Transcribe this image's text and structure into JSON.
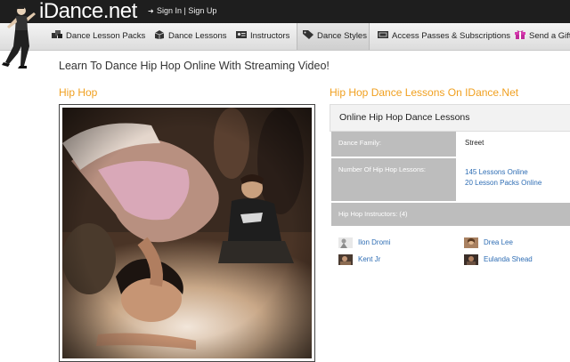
{
  "header": {
    "logo": "iDance.net",
    "auth_links": "Sign In | Sign Up"
  },
  "nav": {
    "items": [
      {
        "label": "Dance Lesson Packs",
        "icon": "lesson-packs-icon"
      },
      {
        "label": "Dance Lessons",
        "icon": "box-icon"
      },
      {
        "label": "Instructors",
        "icon": "id-card-icon"
      },
      {
        "label": "Dance Styles",
        "icon": "tag-icon"
      },
      {
        "label": "Access Passes & Subscriptions",
        "icon": "ticket-icon"
      },
      {
        "label": "Send a Gift",
        "icon": "gift-icon"
      }
    ],
    "active_index": 3
  },
  "page": {
    "headline": "Learn To Dance Hip Hop Online With Streaming Video!",
    "left_title": "Hip Hop",
    "right_title": "Hip Hop Dance Lessons On IDance.Net"
  },
  "info": {
    "heading": "Online Hip Hop Dance Lessons",
    "family_label": "Dance Family:",
    "family_value": "Street",
    "lessons_label": "Number Of Hip Hop Lessons:",
    "lessons_online": "145 Lessons Online",
    "packs_online": "20 Lesson Packs Online",
    "instructors_label": "Hip Hop Instructors: (4)",
    "instructors": [
      "Ilon Dromi",
      "Drea Lee",
      "Kent Jr",
      "Eulanda Shead"
    ]
  },
  "colors": {
    "topbar": "#1e1e1e",
    "accent_orange": "#f0a020",
    "link_blue": "#2e6db4",
    "label_gray": "#bdbdbd"
  }
}
